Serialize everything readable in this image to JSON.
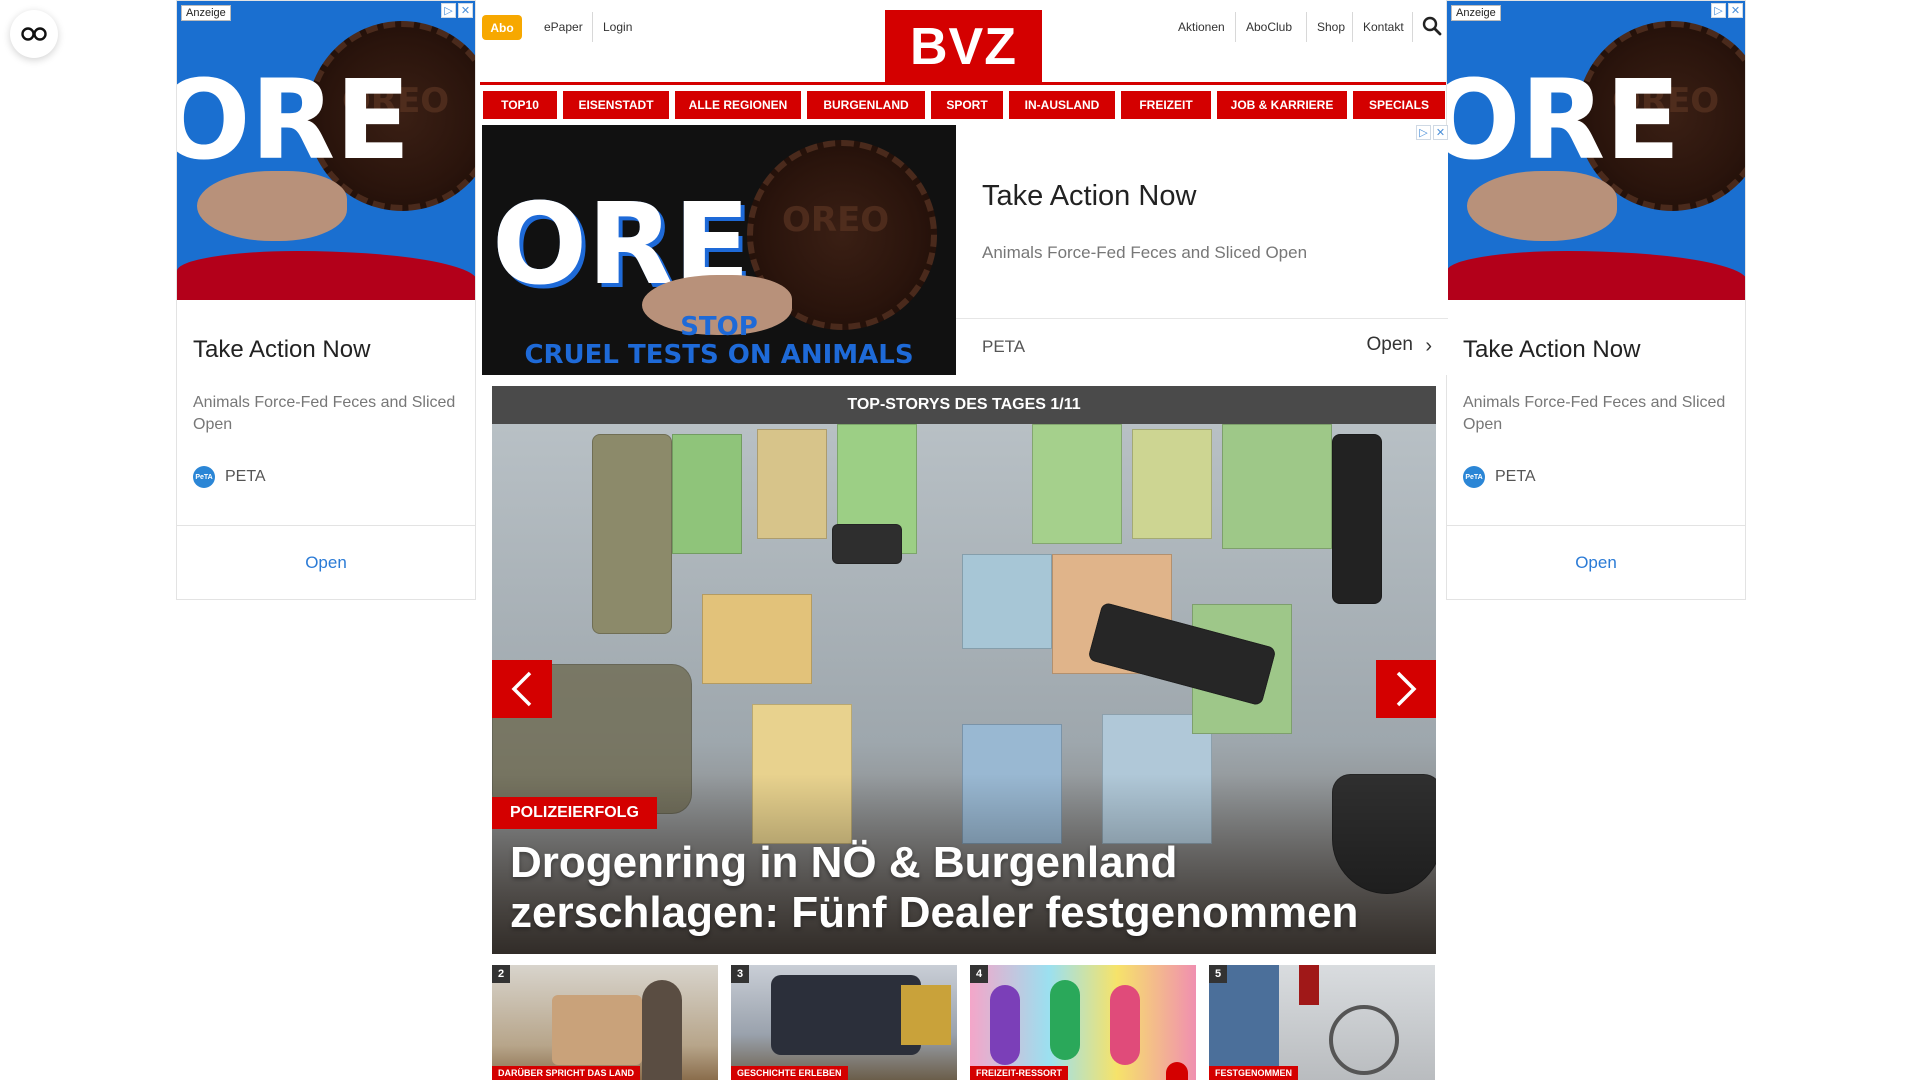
{
  "header": {
    "abo": "Abo",
    "epaper": "ePaper",
    "login": "Login",
    "logo": "BVZ",
    "right_links": [
      "Aktionen",
      "AboClub",
      "Shop",
      "Kontakt"
    ]
  },
  "nav": [
    "TOP10",
    "EISENSTADT",
    "ALLE REGIONEN",
    "BURGENLAND",
    "SPORT",
    "IN-AUSLAND",
    "FREIZEIT",
    "JOB & KARRIERE",
    "SPECIALS"
  ],
  "ads": {
    "label": "Anzeige",
    "title": "Take Action Now",
    "description": "Animals Force-Fed Feces and Sliced Open",
    "brand": "PETA",
    "brand_logo_text": "PeTA",
    "open": "Open",
    "image_text_main": "ORE",
    "image_text_cookie": "OREO",
    "image_text_banner": [
      "STOP",
      "CRUEL TESTS ON ANIMALS"
    ]
  },
  "stories": {
    "header": "TOP-STORYS DES TAGES 1/11",
    "hero": {
      "tag": "POLIZEIERFOLG",
      "title": "Drogenring in NÖ & Burgenland zerschlagen: Fünf Dealer festgenommen"
    },
    "thumbs": [
      {
        "num": "2",
        "label": "DARÜBER SPRICHT DAS LAND"
      },
      {
        "num": "3",
        "label": "GESCHICHTE ERLEBEN"
      },
      {
        "num": "4",
        "label": "FREIZEIT-RESSORT"
      },
      {
        "num": "5",
        "label": "FESTGENOMMEN"
      }
    ]
  },
  "colors": {
    "brand_red": "#d40000",
    "abo_orange": "#f7a800",
    "stories_bar": "#4a4a4a",
    "ad_link_blue": "#2b7bd6"
  }
}
